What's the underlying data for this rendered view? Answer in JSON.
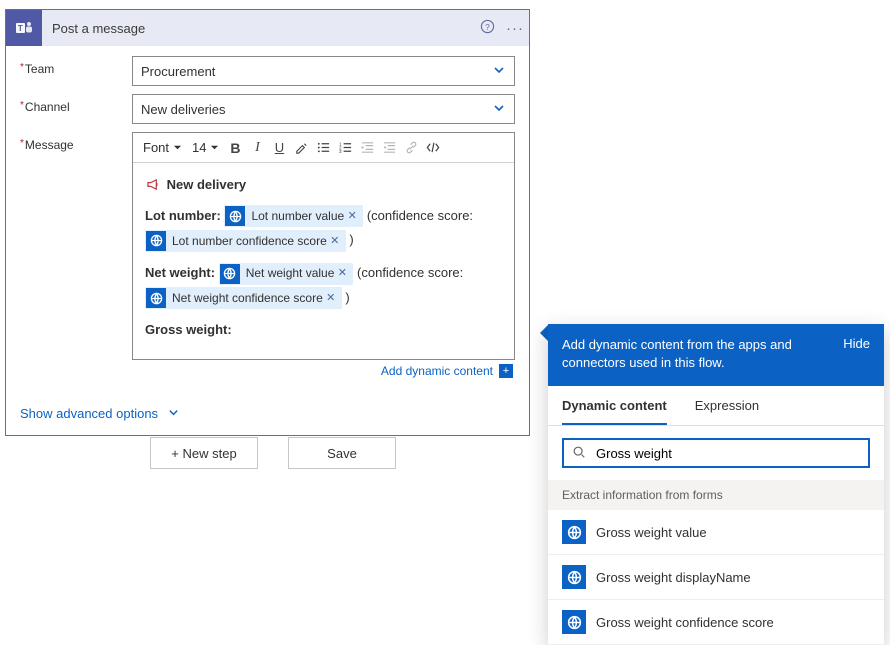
{
  "card": {
    "title": "Post a message",
    "fields": {
      "team_label": "Team",
      "channel_label": "Channel",
      "message_label": "Message"
    },
    "team_value": "Procurement",
    "channel_value": "New deliveries",
    "toolbar": {
      "font_label": "Font",
      "size_label": "14"
    },
    "body": {
      "heading": "New delivery",
      "lot_label": "Lot number:",
      "net_label": "Net weight:",
      "gross_label": "Gross weight:",
      "conf_open": "(confidence score:",
      "conf_close": ")",
      "pills": {
        "lot_value": "Lot number value",
        "lot_conf": "Lot number confidence score",
        "net_value": "Net weight value",
        "net_conf": "Net weight confidence score"
      }
    },
    "add_dynamic": "Add dynamic content",
    "show_advanced": "Show advanced options"
  },
  "buttons": {
    "new_step": "+ New step",
    "save": "Save"
  },
  "pop": {
    "head_msg": "Add dynamic content from the apps and connectors used in this flow.",
    "hide": "Hide",
    "tabs": {
      "dynamic": "Dynamic content",
      "expression": "Expression"
    },
    "search_value": "Gross weight",
    "group_header": "Extract information from forms",
    "items": [
      "Gross weight value",
      "Gross weight displayName",
      "Gross weight confidence score"
    ]
  }
}
